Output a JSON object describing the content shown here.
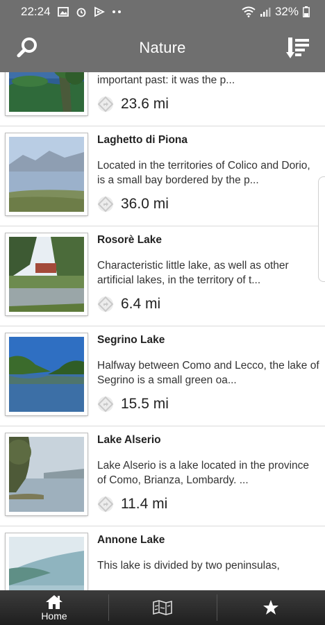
{
  "status_bar": {
    "time": "22:24",
    "battery": "32%",
    "icons": [
      "gallery-icon",
      "alarm-icon",
      "media-icon",
      "more-dots-icon",
      "wifi-icon",
      "signal-icon",
      "battery-icon"
    ]
  },
  "app_bar": {
    "title": "Nature",
    "icons": [
      "search-icon",
      "sort-icon"
    ],
    "color": "#6f6f6f"
  },
  "list": [
    {
      "title": "",
      "description": "The only island of Lake Como boasts an important past: it was the p...",
      "distance": "23.6 mi",
      "thumb": "island"
    },
    {
      "title": "Laghetto di Piona",
      "description": "Located in the territories of Colico and Dorio, is a small bay bordered by the p...",
      "distance": "36.0 mi",
      "thumb": "bay"
    },
    {
      "title": "Rosorè Lake",
      "description": " Characteristic little lake, as well as other artificial lakes, in the territory of t...",
      "distance": "6.4 mi",
      "thumb": "pond"
    },
    {
      "title": "Segrino Lake",
      "description": " Halfway between Como and Lecco, the lake of Segrino is a small green oa...",
      "distance": "15.5 mi",
      "thumb": "lake-blue"
    },
    {
      "title": "Lake Alserio",
      "description": " Lake Alserio is a lake located in the province of Como, Brianza, Lombardy. ...",
      "distance": "11.4 mi",
      "thumb": "lake-tree"
    },
    {
      "title": "Annone Lake",
      "description": " This lake is divided by two peninsulas,",
      "distance": "",
      "thumb": "lake-hazy"
    }
  ],
  "bottom_nav": {
    "home_label": "Home",
    "icons": [
      "home-icon",
      "map-icon",
      "star-icon"
    ]
  }
}
